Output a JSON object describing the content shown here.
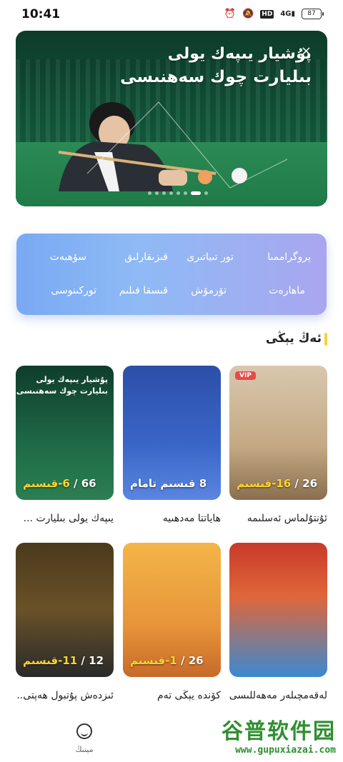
{
  "status_bar": {
    "time": "10:41",
    "hd_label": "HD",
    "signal_label": "4G",
    "battery_level": "87"
  },
  "banner": {
    "title_line1": "پۇشيار يىپەك يولى",
    "title_line2": "بىليارت چوك سەھنىسى",
    "close_symbol": "×",
    "page_count": 8,
    "active_index": 6
  },
  "categories": [
    {
      "label": "پروگراممىا"
    },
    {
      "label": "تور تىياتىرى"
    },
    {
      "label": "قىزىقارلىق"
    },
    {
      "label": "سۆھبەت"
    },
    {
      "label": "ماھارەت"
    },
    {
      "label": "تۆرمۆش"
    },
    {
      "label": "قىسقا فىلىم"
    },
    {
      "label": "توركىنوسى"
    }
  ],
  "section": {
    "title": "ئەڭ يېڭى"
  },
  "tiles": [
    {
      "name": "يىپەك يولى بىليارت ...",
      "badge_total": "66",
      "badge_current": "6-قىسىم",
      "badge_full": ""
    },
    {
      "name": "ھاياتتا مەدھىيە",
      "badge_total": "8",
      "badge_current": "",
      "badge_full": "قىسىم تامام"
    },
    {
      "name": "ئۇنتۇلماس ئەسلىمە",
      "badge_total": "26",
      "badge_current": "16-قىسىم",
      "badge_full": "",
      "vip": "VIP"
    },
    {
      "name": "ئىزدەش پۇتبول ھەپتى...",
      "badge_total": "12",
      "badge_current": "11-قىسىم",
      "badge_full": ""
    },
    {
      "name": "كۆندە يېڭى تەم",
      "badge_total": "26",
      "badge_current": "1-قىسىم",
      "badge_full": ""
    },
    {
      "name": "لەقەمچىلەر مەھەللىسى",
      "badge_total": "",
      "badge_current": "",
      "badge_full": ""
    }
  ],
  "bottom_nav": {
    "label": "مېنىڭ"
  },
  "watermark": {
    "top": "谷普软件园",
    "bottom": "www.gupuxiazai.com"
  },
  "colors": {
    "accent_yellow": "#ffd530",
    "section_bar": "#f5d23a",
    "category_gradient_start": "#79a9f3",
    "category_gradient_end": "#a9a6ef"
  }
}
